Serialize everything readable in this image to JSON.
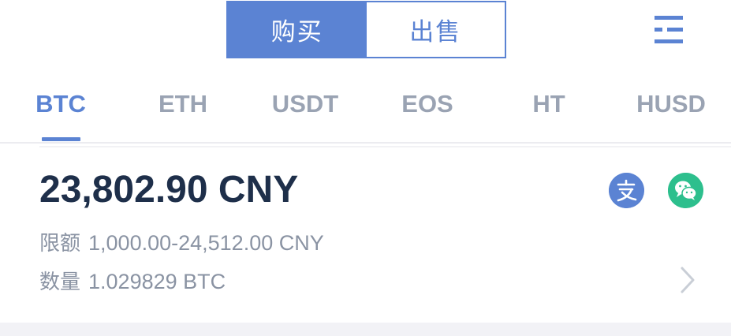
{
  "trade_toggle": {
    "buy_label": "购买",
    "sell_label": "出售",
    "active": "buy"
  },
  "coin_tabs": [
    {
      "label": "BTC",
      "active": true
    },
    {
      "label": "ETH",
      "active": false
    },
    {
      "label": "USDT",
      "active": false
    },
    {
      "label": "EOS",
      "active": false
    },
    {
      "label": "HT",
      "active": false
    },
    {
      "label": "HUSD",
      "active": false
    }
  ],
  "offer": {
    "price": "23,802.90 CNY",
    "limit_label": "限额",
    "limit_value": "1,000.00-24,512.00 CNY",
    "quantity_label": "数量",
    "quantity_value": "1.029829 BTC",
    "payment_methods": [
      "alipay-icon",
      "wechat-pay-icon"
    ]
  },
  "colors": {
    "accent": "#5b83d3",
    "wechat": "#2dbf8d",
    "price_text": "#1e2f4a",
    "muted_text": "#8a93a3"
  }
}
